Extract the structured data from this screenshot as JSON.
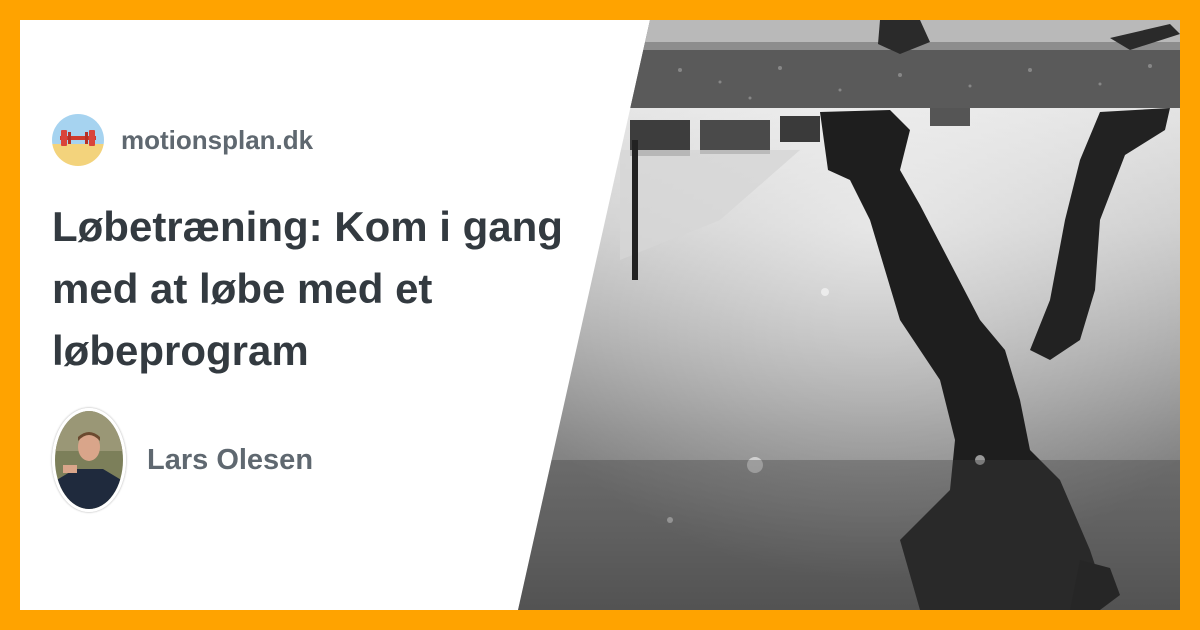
{
  "site": {
    "name": "motionsplan.dk",
    "logo_icon": "dumbbell-beach-logo-icon"
  },
  "article": {
    "title": "Løbetræning: Kom i gang med at løbe med et løbeprogram"
  },
  "author": {
    "name": "Lars Olesen",
    "avatar_icon": "author-portrait"
  },
  "photo": {
    "subject": "runner-reflection-in-puddle-icon"
  },
  "colors": {
    "border": "#FFA300",
    "title_text": "#333a40",
    "muted_text": "#5f6870",
    "card_background": "#ffffff"
  }
}
